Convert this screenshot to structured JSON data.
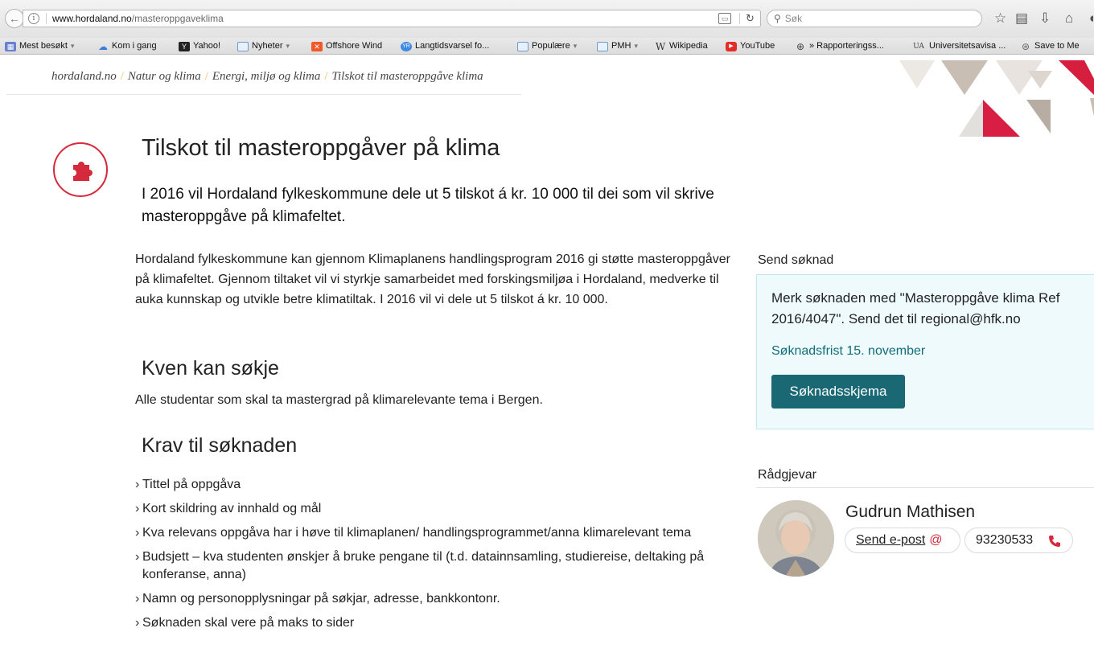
{
  "browser": {
    "url_domain": "www.hordaland.no",
    "url_path": "/masteroppgaveklima",
    "search_placeholder": "Søk",
    "bookmarks": [
      {
        "label": "Mest besøkt",
        "icon": "most-visited-icon",
        "caret": "▾"
      },
      {
        "label": "Kom i gang",
        "icon": "cloud-icon"
      },
      {
        "label": "Yahoo!",
        "icon": "yahoo-icon"
      },
      {
        "label": "Nyheter",
        "icon": "folder-icon",
        "caret": "▾"
      },
      {
        "label": "Offshore Wind",
        "icon": "offshore-wind-icon"
      },
      {
        "label": "Langtidsvarsel fo...",
        "icon": "yr-icon"
      },
      {
        "label": "Populære",
        "icon": "folder-icon",
        "caret": "▾"
      },
      {
        "label": "PMH",
        "icon": "folder-icon",
        "caret": "▾"
      },
      {
        "label": "Wikipedia",
        "icon": "wikipedia-icon"
      },
      {
        "label": "YouTube",
        "icon": "youtube-icon"
      },
      {
        "label": "» Rapporteringss...",
        "icon": "globe-icon"
      },
      {
        "label": "Universitetsavisa ...",
        "icon": "ua-icon"
      },
      {
        "label": "Save to Me",
        "icon": "save-icon"
      }
    ],
    "bookmark_icon_text": {
      "yahoo": "Y",
      "ua": "UA",
      "wikipedia": "W",
      "yr": "YR"
    }
  },
  "breadcrumb": {
    "items": [
      "hordaland.no",
      "Natur og klima",
      "Energi, miljø og klima",
      "Tilskot til masteroppgåve klima"
    ],
    "separator": "/"
  },
  "colors": {
    "accent_red": "#d42a3c",
    "teal_button": "#1a6874",
    "teal_link": "#0f6e78",
    "box_bg": "#effafc"
  },
  "main": {
    "title": "Tilskot til masteroppgåver på klima",
    "lead": "I 2016 vil Hordaland fylkeskommune dele ut 5 tilskot á kr. 10 000 til dei som vil skrive masteroppgåve på klimafeltet.",
    "body": "Hordaland fylkeskommune kan gjennom Klimaplanens handlingsprogram 2016 gi støtte masteroppgåver på klimafeltet. Gjennom tiltaket vil vi styrkje samarbeidet med forskingsmiljøa i Hordaland, medverke til auka kunnskap og utvikle betre klimatiltak. I 2016 vil vi dele ut 5 tilskot á kr. 10 000.",
    "who_heading": "Kven kan søkje",
    "who_text": "Alle studentar som skal ta mastergrad på klimarelevante tema i Bergen.",
    "req_heading": "Krav til søknaden",
    "requirements": [
      "Tittel på oppgåva",
      "Kort skildring av innhald og mål",
      "Kva relevans oppgåva har i høve til klimaplanen/ handlingsprogrammet/anna klimarelevant tema",
      "Budsjett – kva studenten ønskjer å bruke pengane til (t.d. datainnsamling, studiereise, deltaking på konferanse, anna)",
      "Namn og personopplysningar på søkjar, adresse, bankkontonr.",
      "Søknaden skal vere på maks to sider"
    ]
  },
  "sidebar": {
    "apply_heading": "Send søknad",
    "apply_text": "Merk søknaden med \"Masteroppgåve klima Ref 2016/4047\". Send det til regional@hfk.no",
    "deadline": "Søknadsfrist 15. november",
    "apply_button": "Søknadsskjema",
    "adviser_heading": "Rådgjevar",
    "adviser_name": "Gudrun Mathisen",
    "email_label": "Send e-post",
    "email_icon": "@",
    "phone": "93230533"
  }
}
